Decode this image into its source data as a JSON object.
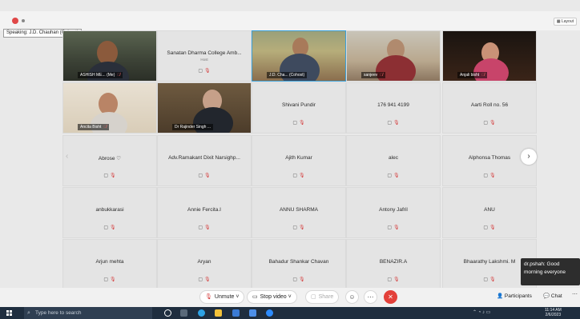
{
  "speaking_label": "Speaking: J.D. Chauhan (Cohost)",
  "layout_label": "Layout",
  "video_tiles": [
    {
      "name": "ASHISH ME...",
      "tag": "(Me)"
    },
    {
      "name": "J.D. Cha...",
      "tag": "(Cohost)"
    },
    {
      "name": "sanjeev",
      "tag": ""
    },
    {
      "name": "Anjali bisht",
      "tag": ""
    },
    {
      "name": "Ancita Bisht",
      "tag": ""
    },
    {
      "name": "Dr Rajinder Singh ...",
      "tag": ""
    }
  ],
  "college_tile": {
    "name": "Sanatan Dharma College Amb...",
    "sub": "Host"
  },
  "name_tiles": [
    "Shivani Pundir",
    "176 941 4199",
    "Aarti Roll no. 56",
    "Abrose ♡",
    "Adv.Ramakant Dixit Narsighp...",
    "Ajith Kumar",
    "alec",
    "Alphonsa Thomas",
    "anbukkarasi",
    "Annie Fercita.I",
    "ANNU SHARMA",
    "Antony Jafril",
    "ANU",
    "Arjun mehta",
    "Aryan",
    "Bahadur Shankar Chavan",
    "BENAZIR.A",
    "Bhaarathy Lakshmi. M"
  ],
  "toolbar": {
    "unmute": "Unmute",
    "stop_video": "Stop video",
    "share": "Share",
    "participants": "Participants",
    "chat": "Chat"
  },
  "chat_popup": {
    "text": "dr.pshah: Good morning everyone"
  },
  "taskbar": {
    "search_placeholder": "Type here to search",
    "time": "11:14 AM",
    "date": "2/6/2023"
  },
  "colors": {
    "accent_border": "#3aa0d8",
    "leave": "#e3413a",
    "mute_red": "#d43c3c"
  }
}
